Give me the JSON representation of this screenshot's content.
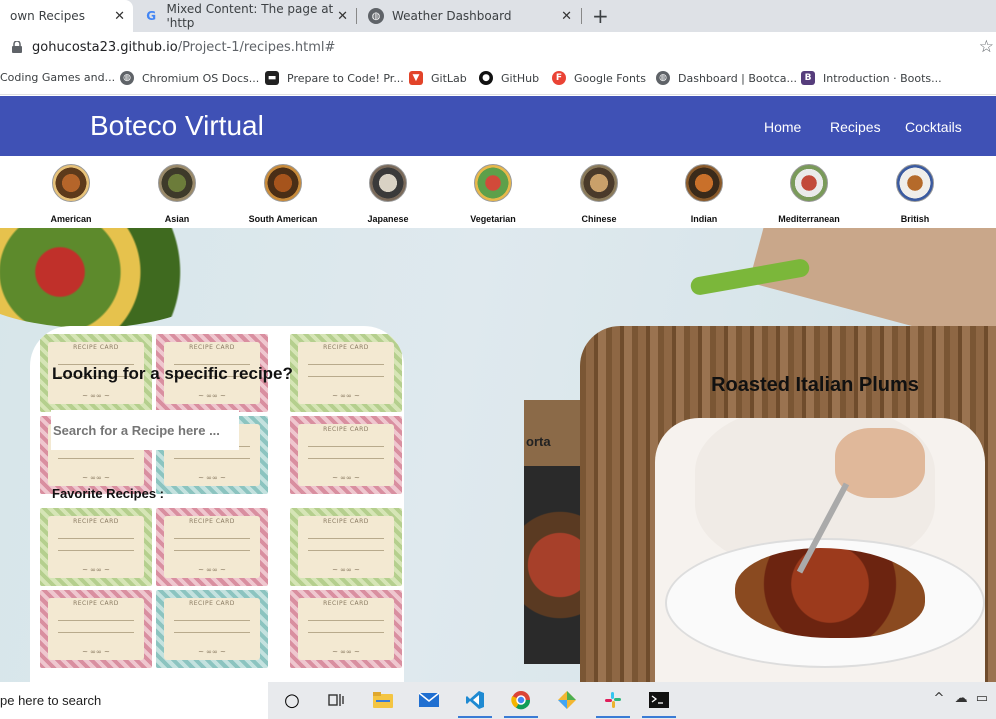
{
  "browser": {
    "tabs": [
      {
        "title": "own Recipes",
        "close": "✕"
      },
      {
        "title": "Mixed Content: The page at 'http",
        "close": "✕",
        "favicon": "google-icon"
      },
      {
        "title": "Weather Dashboard",
        "close": "✕",
        "favicon": "globe-icon"
      }
    ],
    "new_tab": "+",
    "url_host": "gohucosta23.github.io",
    "url_path": "/Project-1/recipes.html#",
    "bookmarks": [
      {
        "label": "Coding Games and...",
        "icon": "none"
      },
      {
        "label": "Chromium OS Docs...",
        "icon": "globe-icon"
      },
      {
        "label": "Prepare to Code! Pr...",
        "icon": "book-icon"
      },
      {
        "label": "GitLab",
        "icon": "gitlab-icon"
      },
      {
        "label": "GitHub",
        "icon": "github-icon"
      },
      {
        "label": "Google Fonts",
        "icon": "fonts-icon"
      },
      {
        "label": "Dashboard | Bootca...",
        "icon": "globe-icon"
      },
      {
        "label": "Introduction · Boots...",
        "icon": "bootstrap-icon"
      }
    ]
  },
  "site": {
    "brand": "Boteco Virtual",
    "nav": [
      "Home",
      "Recipes",
      "Cocktails"
    ],
    "categories": [
      "American",
      "Asian",
      "South American",
      "Japanese",
      "Vegetarian",
      "Chinese",
      "Indian",
      "Mediterranean",
      "British"
    ],
    "search_heading": "Looking for a specific recipe?",
    "search_placeholder": "Search for a Recipe here ...",
    "favorites_label": "Favorite Recipes :",
    "recipe_card_label": "RECIPE CARD",
    "back_card_title": "orta",
    "recipe_title": "Roasted Italian Plums"
  },
  "taskbar": {
    "search_text": "pe here to search",
    "tray": "^"
  },
  "colors": {
    "navbar": "#3f51b5",
    "taskbar": "#e8eaed"
  }
}
